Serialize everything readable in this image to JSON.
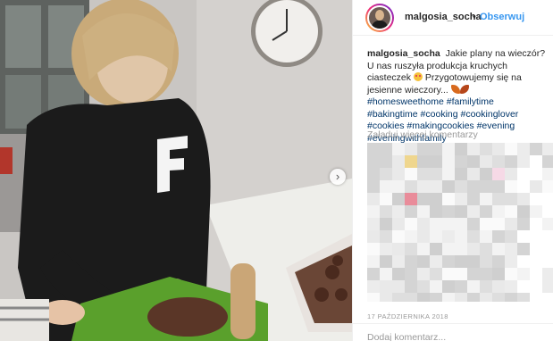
{
  "post": {
    "username": "malgosia_socha",
    "separator": "•",
    "follow_label": "Obserwuj",
    "caption_text": "Jakie plany na wieczór? U nas ruszyła produkcja kruchych ciasteczek",
    "caption_text_2": "Przygotowujemy się na jesienne wieczory...",
    "hashtags": [
      "#homesweethome",
      "#familytime",
      "#bakingtime",
      "#cooking",
      "#cookinglover",
      "#cookies",
      "#makingcookies",
      "#evening",
      "#eveningwithfamily"
    ],
    "load_more_label": "Załaduj więcej komentarzy",
    "date": "17 PAŹDZIERNIKA 2018",
    "add_comment_placeholder": "Dodaj komentarz..."
  },
  "icons": {
    "carousel_next": "chevron-right-icon",
    "caption_emoji_1": "heart-eyes-emoji-icon",
    "caption_emoji_2": "maple-leaf-emoji-icon",
    "caption_emoji_3": "fallen-leaf-emoji-icon"
  },
  "colors": {
    "link": "#003569",
    "follow": "#3897f0",
    "muted": "#999999",
    "text": "#262626"
  }
}
